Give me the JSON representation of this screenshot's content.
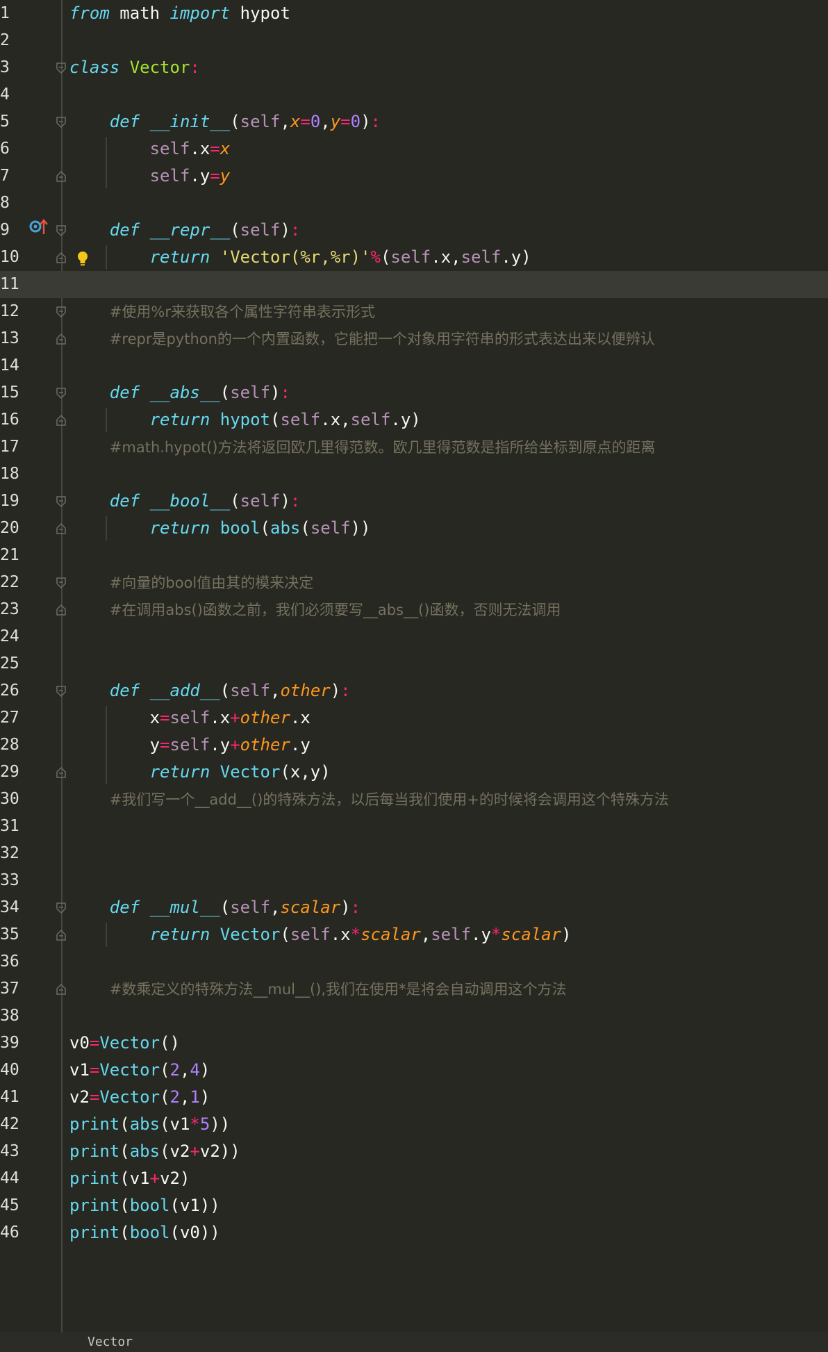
{
  "editor": {
    "lines": [
      {
        "n": "1",
        "tokens": [
          [
            "kw",
            "from"
          ],
          [
            "plain",
            " math "
          ],
          [
            "kw",
            "import"
          ],
          [
            "plain",
            " hypot"
          ]
        ]
      },
      {
        "n": "2",
        "tokens": []
      },
      {
        "n": "3",
        "tokens": [
          [
            "kw",
            "class"
          ],
          [
            "plain",
            " "
          ],
          [
            "cls",
            "Vector"
          ],
          [
            "op",
            ":"
          ]
        ]
      },
      {
        "n": "4",
        "tokens": []
      },
      {
        "n": "5",
        "tokens": [
          [
            "plain",
            "    "
          ],
          [
            "kw",
            "def"
          ],
          [
            "plain",
            " "
          ],
          [
            "fn",
            "__init__"
          ],
          [
            "plain",
            "("
          ],
          [
            "self",
            "self"
          ],
          [
            "plain",
            ","
          ],
          [
            "param",
            "x"
          ],
          [
            "op",
            "="
          ],
          [
            "num",
            "0"
          ],
          [
            "plain",
            ","
          ],
          [
            "param",
            "y"
          ],
          [
            "op",
            "="
          ],
          [
            "num",
            "0"
          ],
          [
            "plain",
            ")"
          ],
          [
            "op",
            ":"
          ]
        ]
      },
      {
        "n": "6",
        "tokens": [
          [
            "plain",
            "        "
          ],
          [
            "self",
            "self"
          ],
          [
            "plain",
            ".x"
          ],
          [
            "op",
            "="
          ],
          [
            "param",
            "x"
          ]
        ]
      },
      {
        "n": "7",
        "tokens": [
          [
            "plain",
            "        "
          ],
          [
            "self",
            "self"
          ],
          [
            "plain",
            ".y"
          ],
          [
            "op",
            "="
          ],
          [
            "param",
            "y"
          ]
        ]
      },
      {
        "n": "8",
        "tokens": []
      },
      {
        "n": "9",
        "tokens": [
          [
            "plain",
            "    "
          ],
          [
            "kw",
            "def"
          ],
          [
            "plain",
            " "
          ],
          [
            "fn",
            "__repr__"
          ],
          [
            "plain",
            "("
          ],
          [
            "self",
            "self"
          ],
          [
            "plain",
            ")"
          ],
          [
            "op",
            ":"
          ]
        ]
      },
      {
        "n": "10",
        "tokens": [
          [
            "plain",
            "        "
          ],
          [
            "kw",
            "return"
          ],
          [
            "plain",
            " "
          ],
          [
            "str",
            "'Vector(%r,%r)'"
          ],
          [
            "op",
            "%"
          ],
          [
            "plain",
            "("
          ],
          [
            "self",
            "self"
          ],
          [
            "plain",
            ".x,"
          ],
          [
            "self",
            "self"
          ],
          [
            "plain",
            ".y)"
          ]
        ]
      },
      {
        "n": "11",
        "tokens": [],
        "current": true
      },
      {
        "n": "12",
        "tokens": [
          [
            "plain",
            "    "
          ],
          [
            "comment",
            "#使用%r来获取各个属性字符串表示形式"
          ]
        ]
      },
      {
        "n": "13",
        "tokens": [
          [
            "plain",
            "    "
          ],
          [
            "comment",
            "#repr是python的一个内置函数，它能把一个对象用字符串的形式表达出来以便辨认"
          ]
        ]
      },
      {
        "n": "14",
        "tokens": []
      },
      {
        "n": "15",
        "tokens": [
          [
            "plain",
            "    "
          ],
          [
            "kw",
            "def"
          ],
          [
            "plain",
            " "
          ],
          [
            "fn",
            "__abs__"
          ],
          [
            "plain",
            "("
          ],
          [
            "self",
            "self"
          ],
          [
            "plain",
            ")"
          ],
          [
            "op",
            ":"
          ]
        ]
      },
      {
        "n": "16",
        "tokens": [
          [
            "plain",
            "        "
          ],
          [
            "kw",
            "return"
          ],
          [
            "plain",
            " "
          ],
          [
            "builtin",
            "hypot"
          ],
          [
            "plain",
            "("
          ],
          [
            "self",
            "self"
          ],
          [
            "plain",
            ".x,"
          ],
          [
            "self",
            "self"
          ],
          [
            "plain",
            ".y)"
          ]
        ]
      },
      {
        "n": "17",
        "tokens": [
          [
            "plain",
            "    "
          ],
          [
            "comment",
            "#math.hypot()方法将返回欧几里得范数。欧几里得范数是指所给坐标到原点的距离"
          ]
        ]
      },
      {
        "n": "18",
        "tokens": []
      },
      {
        "n": "19",
        "tokens": [
          [
            "plain",
            "    "
          ],
          [
            "kw",
            "def"
          ],
          [
            "plain",
            " "
          ],
          [
            "fn",
            "__bool__"
          ],
          [
            "plain",
            "("
          ],
          [
            "self",
            "self"
          ],
          [
            "plain",
            ")"
          ],
          [
            "op",
            ":"
          ]
        ]
      },
      {
        "n": "20",
        "tokens": [
          [
            "plain",
            "        "
          ],
          [
            "kw",
            "return"
          ],
          [
            "plain",
            " "
          ],
          [
            "builtin",
            "bool"
          ],
          [
            "plain",
            "("
          ],
          [
            "builtin",
            "abs"
          ],
          [
            "plain",
            "("
          ],
          [
            "self",
            "self"
          ],
          [
            "plain",
            "))"
          ]
        ]
      },
      {
        "n": "21",
        "tokens": []
      },
      {
        "n": "22",
        "tokens": [
          [
            "plain",
            "    "
          ],
          [
            "comment",
            "#向量的bool值由其的模来决定"
          ]
        ]
      },
      {
        "n": "23",
        "tokens": [
          [
            "plain",
            "    "
          ],
          [
            "comment",
            "#在调用abs()函数之前，我们必须要写__abs__()函数，否则无法调用"
          ]
        ]
      },
      {
        "n": "24",
        "tokens": []
      },
      {
        "n": "25",
        "tokens": []
      },
      {
        "n": "26",
        "tokens": [
          [
            "plain",
            "    "
          ],
          [
            "kw",
            "def"
          ],
          [
            "plain",
            " "
          ],
          [
            "fn",
            "__add__"
          ],
          [
            "plain",
            "("
          ],
          [
            "self",
            "self"
          ],
          [
            "plain",
            ","
          ],
          [
            "param",
            "other"
          ],
          [
            "plain",
            ")"
          ],
          [
            "op",
            ":"
          ]
        ]
      },
      {
        "n": "27",
        "tokens": [
          [
            "plain",
            "        x"
          ],
          [
            "op",
            "="
          ],
          [
            "self",
            "self"
          ],
          [
            "plain",
            ".x"
          ],
          [
            "op",
            "+"
          ],
          [
            "param",
            "other"
          ],
          [
            "plain",
            ".x"
          ]
        ]
      },
      {
        "n": "28",
        "tokens": [
          [
            "plain",
            "        y"
          ],
          [
            "op",
            "="
          ],
          [
            "self",
            "self"
          ],
          [
            "plain",
            ".y"
          ],
          [
            "op",
            "+"
          ],
          [
            "param",
            "other"
          ],
          [
            "plain",
            ".y"
          ]
        ]
      },
      {
        "n": "29",
        "tokens": [
          [
            "plain",
            "        "
          ],
          [
            "kw",
            "return"
          ],
          [
            "plain",
            " "
          ],
          [
            "builtin",
            "Vector"
          ],
          [
            "plain",
            "(x,y)"
          ]
        ]
      },
      {
        "n": "30",
        "tokens": [
          [
            "plain",
            "    "
          ],
          [
            "comment",
            "#我们写一个__add__()的特殊方法，以后每当我们使用+的时候将会调用这个特殊方法"
          ]
        ]
      },
      {
        "n": "31",
        "tokens": []
      },
      {
        "n": "32",
        "tokens": []
      },
      {
        "n": "33",
        "tokens": []
      },
      {
        "n": "34",
        "tokens": [
          [
            "plain",
            "    "
          ],
          [
            "kw",
            "def"
          ],
          [
            "plain",
            " "
          ],
          [
            "fn",
            "__mul__"
          ],
          [
            "plain",
            "("
          ],
          [
            "self",
            "self"
          ],
          [
            "plain",
            ","
          ],
          [
            "param",
            "scalar"
          ],
          [
            "plain",
            ")"
          ],
          [
            "op",
            ":"
          ]
        ]
      },
      {
        "n": "35",
        "tokens": [
          [
            "plain",
            "        "
          ],
          [
            "kw",
            "return"
          ],
          [
            "plain",
            " "
          ],
          [
            "builtin",
            "Vector"
          ],
          [
            "plain",
            "("
          ],
          [
            "self",
            "self"
          ],
          [
            "plain",
            ".x"
          ],
          [
            "op",
            "*"
          ],
          [
            "param",
            "scalar"
          ],
          [
            "plain",
            ","
          ],
          [
            "self",
            "self"
          ],
          [
            "plain",
            ".y"
          ],
          [
            "op",
            "*"
          ],
          [
            "param",
            "scalar"
          ],
          [
            "plain",
            ")"
          ]
        ]
      },
      {
        "n": "36",
        "tokens": []
      },
      {
        "n": "37",
        "tokens": [
          [
            "plain",
            "    "
          ],
          [
            "comment",
            "#数乘定义的特殊方法__mul__(),我们在使用*是将会自动调用这个方法"
          ]
        ]
      },
      {
        "n": "38",
        "tokens": []
      },
      {
        "n": "39",
        "tokens": [
          [
            "plain",
            "v0"
          ],
          [
            "op",
            "="
          ],
          [
            "builtin",
            "Vector"
          ],
          [
            "plain",
            "()"
          ]
        ]
      },
      {
        "n": "40",
        "tokens": [
          [
            "plain",
            "v1"
          ],
          [
            "op",
            "="
          ],
          [
            "builtin",
            "Vector"
          ],
          [
            "plain",
            "("
          ],
          [
            "num",
            "2"
          ],
          [
            "plain",
            ","
          ],
          [
            "num",
            "4"
          ],
          [
            "plain",
            ")"
          ]
        ]
      },
      {
        "n": "41",
        "tokens": [
          [
            "plain",
            "v2"
          ],
          [
            "op",
            "="
          ],
          [
            "builtin",
            "Vector"
          ],
          [
            "plain",
            "("
          ],
          [
            "num",
            "2"
          ],
          [
            "plain",
            ","
          ],
          [
            "num",
            "1"
          ],
          [
            "plain",
            ")"
          ]
        ]
      },
      {
        "n": "42",
        "tokens": [
          [
            "builtin",
            "print"
          ],
          [
            "plain",
            "("
          ],
          [
            "builtin",
            "abs"
          ],
          [
            "plain",
            "(v1"
          ],
          [
            "op",
            "*"
          ],
          [
            "num",
            "5"
          ],
          [
            "plain",
            "))"
          ]
        ]
      },
      {
        "n": "43",
        "tokens": [
          [
            "builtin",
            "print"
          ],
          [
            "plain",
            "("
          ],
          [
            "builtin",
            "abs"
          ],
          [
            "plain",
            "(v2"
          ],
          [
            "op",
            "+"
          ],
          [
            "plain",
            "v2))"
          ]
        ]
      },
      {
        "n": "44",
        "tokens": [
          [
            "builtin",
            "print"
          ],
          [
            "plain",
            "(v1"
          ],
          [
            "op",
            "+"
          ],
          [
            "plain",
            "v2)"
          ]
        ]
      },
      {
        "n": "45",
        "tokens": [
          [
            "builtin",
            "print"
          ],
          [
            "plain",
            "("
          ],
          [
            "builtin",
            "bool"
          ],
          [
            "plain",
            "(v1))"
          ]
        ]
      },
      {
        "n": "46",
        "tokens": [
          [
            "builtin",
            "print"
          ],
          [
            "plain",
            "("
          ],
          [
            "builtin",
            "bool"
          ],
          [
            "plain",
            "(v0))"
          ]
        ]
      }
    ],
    "folds_open": [
      "3",
      "5",
      "9",
      "12",
      "15",
      "19",
      "22",
      "26",
      "34"
    ],
    "folds_close": [
      "7",
      "10",
      "13",
      "16",
      "20",
      "23",
      "29",
      "35",
      "37"
    ],
    "gutter_icons": {
      "override_marker_line": "9",
      "override_icon": "override-up-arrow-icon",
      "bulb_line": "10",
      "bulb_icon": "lightbulb-icon"
    }
  },
  "statusbar": {
    "breadcrumb": "Vector"
  },
  "colors": {
    "background": "#272822",
    "keyword": "#66d9ef",
    "class_name": "#a6e22e",
    "self": "#b792b7",
    "param": "#fd971f",
    "operator": "#f92672",
    "number": "#ae81ff",
    "string": "#e6db74",
    "comment": "#75715e",
    "current_line": "#3b3b35"
  }
}
